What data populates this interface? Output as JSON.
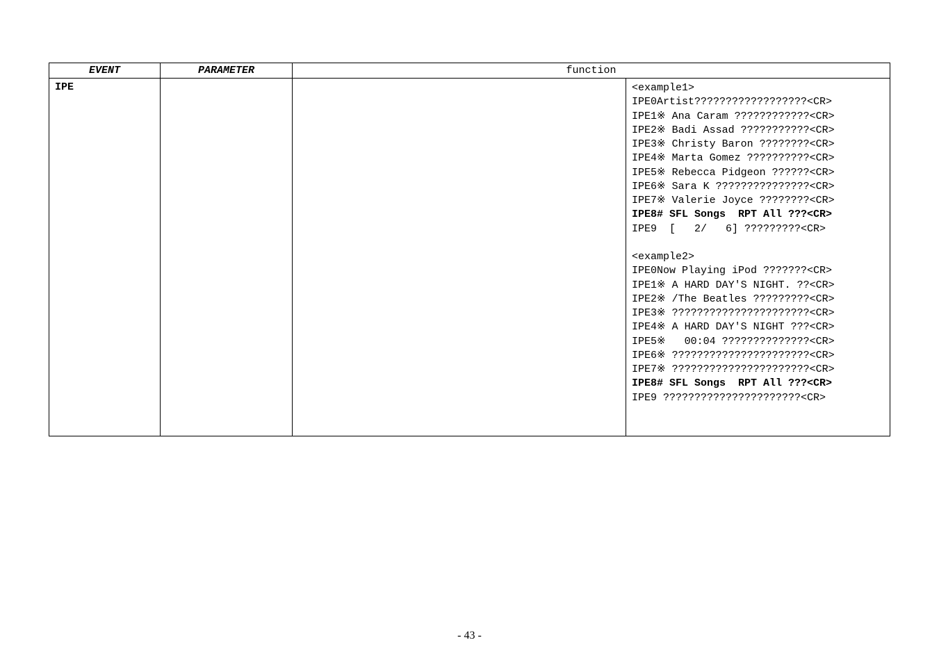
{
  "headers": {
    "event": "EVENT",
    "parameter": "PARAMETER",
    "function": "function"
  },
  "row": {
    "event": "IPE",
    "parameter": "",
    "function": "",
    "output_lines": [
      {
        "text": "<example1>",
        "bold": false
      },
      {
        "text": "IPE0Artist??????????????????<CR>",
        "bold": false
      },
      {
        "text": "IPE1※ Ana Caram ????????????<CR>",
        "bold": false
      },
      {
        "text": "IPE2※ Badi Assad ???????????<CR>",
        "bold": false
      },
      {
        "text": "IPE3※ Christy Baron ????????<CR>",
        "bold": false
      },
      {
        "text": "IPE4※ Marta Gomez ??????????<CR>",
        "bold": false
      },
      {
        "text": "IPE5※ Rebecca Pidgeon ??????<CR>",
        "bold": false
      },
      {
        "text": "IPE6※ Sara K ???????????????<CR>",
        "bold": false
      },
      {
        "text": "IPE7※ Valerie Joyce ????????<CR>",
        "bold": false
      },
      {
        "text": "IPE8# SFL Songs  RPT All ???<CR>",
        "bold": true
      },
      {
        "text": "IPE9  [   2/   6] ?????????<CR>",
        "bold": false
      },
      {
        "text": "",
        "bold": false
      },
      {
        "text": "<example2>",
        "bold": false
      },
      {
        "text": "IPE0Now Playing iPod ???????<CR>",
        "bold": false
      },
      {
        "text": "IPE1※ A HARD DAY'S NIGHT. ??<CR>",
        "bold": false
      },
      {
        "text": "IPE2※ /The Beatles ?????????<CR>",
        "bold": false
      },
      {
        "text": "IPE3※ ??????????????????????<CR>",
        "bold": false
      },
      {
        "text": "IPE4※ A HARD DAY'S NIGHT ???<CR>",
        "bold": false
      },
      {
        "text": "IPE5※   00:04 ??????????????<CR>",
        "bold": false
      },
      {
        "text": "IPE6※ ??????????????????????<CR>",
        "bold": false
      },
      {
        "text": "IPE7※ ??????????????????????<CR>",
        "bold": false
      },
      {
        "text": "IPE8# SFL Songs  RPT All ???<CR>",
        "bold": true
      },
      {
        "text": "IPE9 ??????????????????????<CR>",
        "bold": false
      },
      {
        "text": "",
        "bold": false
      },
      {
        "text": "",
        "bold": false
      }
    ]
  },
  "page_number": "- 43 -"
}
